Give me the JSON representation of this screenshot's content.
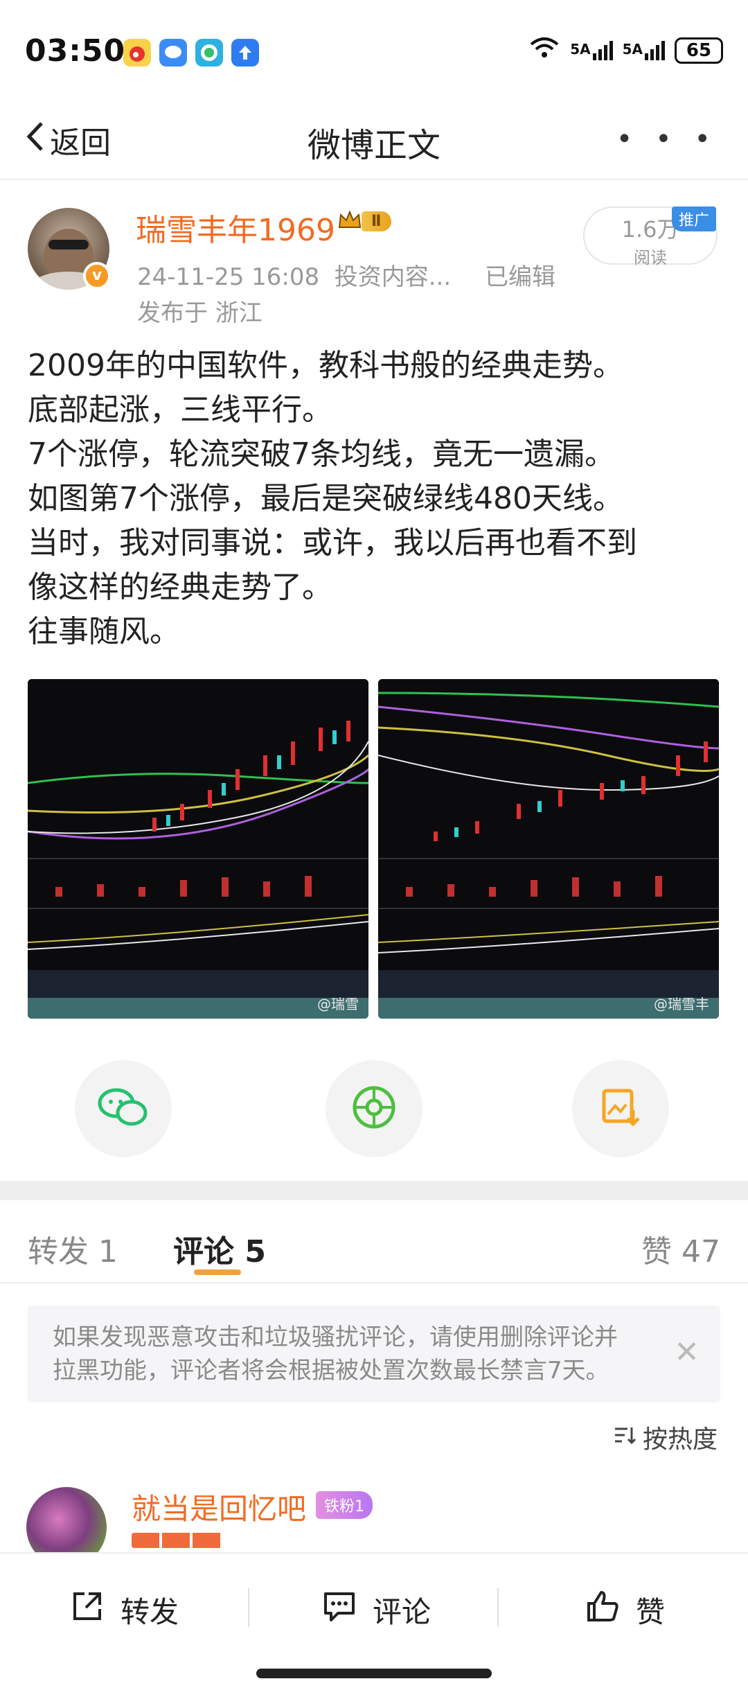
{
  "status_bar": {
    "time": "03:50",
    "battery": "65",
    "net1": "5A",
    "net2": "5A"
  },
  "nav": {
    "back_label": "返回",
    "title": "微博正文",
    "more_label": "• • •"
  },
  "post": {
    "author": "瑞雪丰年1969",
    "level_badge": "Ⅱ",
    "timestamp": "24-11-25 16:08",
    "source": "投资内容...",
    "edited": "已编辑",
    "location": "发布于 浙江",
    "reads_count": "1.6万",
    "reads_label": "阅读",
    "promo_label": "推广",
    "lines": [
      "2009年的中国软件，教科书般的经典走势。",
      "底部起涨，三线平行。",
      "7个涨停，轮流突破7条均线，竟无一遗漏。",
      "如图第7个涨停，最后是突破绿线480天线。",
      "当时，我对同事说：或许，我以后再也看不到",
      "像这样的经典走势了。",
      "往事随风。"
    ],
    "image_watermark_1": "@瑞雪",
    "image_watermark_2": "@瑞雪丰"
  },
  "tabs": {
    "repost": "转发 1",
    "comments": "评论 5",
    "likes": "赞 47"
  },
  "notice": {
    "line1": "如果发现恶意攻击和垃圾骚扰评论，请使用删除评论并",
    "line2": "拉黑功能，评论者将会根据被处置次数最长禁言7天。",
    "close": "✕"
  },
  "sort_label": "按热度",
  "comment": {
    "name": "就当是回忆吧",
    "fan_badge": "铁粉1"
  },
  "bottom_bar": {
    "repost": "转发",
    "comment": "评论",
    "like": "赞"
  },
  "colors": {
    "accent": "#f26b22",
    "tab_indicator": "#f6a03a",
    "wechat": "#25c16f",
    "moments": "#4cbf3f",
    "save": "#f5a623"
  }
}
